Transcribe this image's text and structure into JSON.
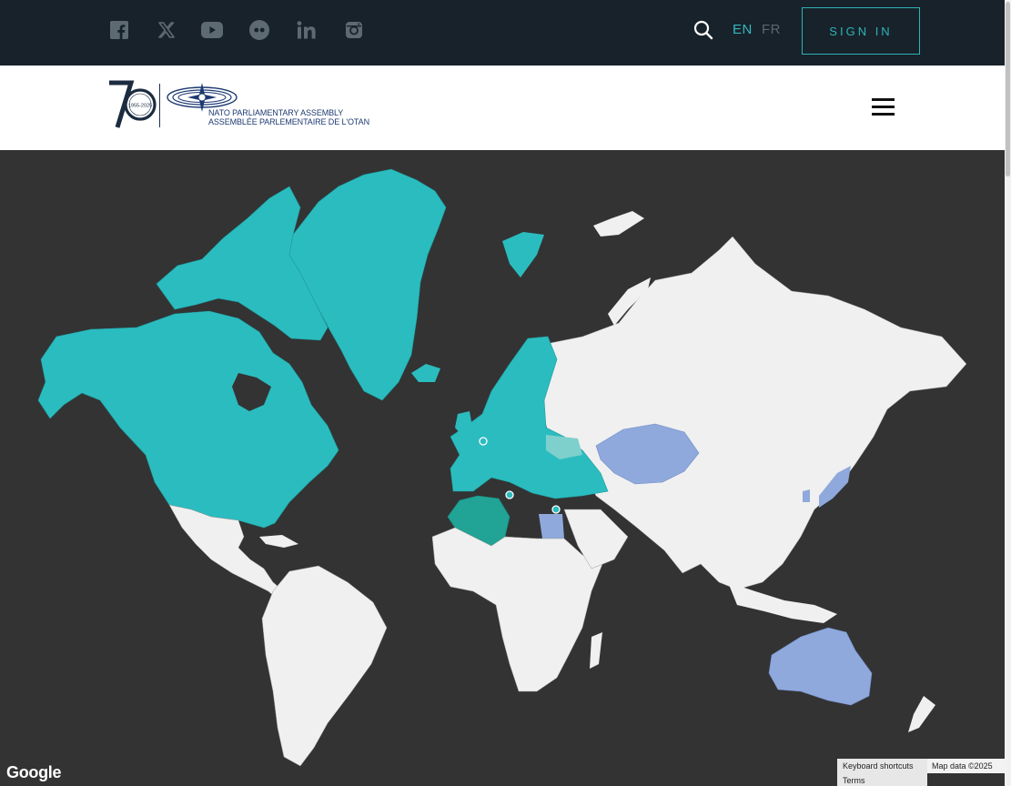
{
  "topbar": {
    "social": [
      {
        "name": "facebook-icon"
      },
      {
        "name": "x-icon"
      },
      {
        "name": "youtube-icon"
      },
      {
        "name": "flickr-icon"
      },
      {
        "name": "linkedin-icon"
      },
      {
        "name": "instagram-icon"
      }
    ],
    "lang_en": "EN",
    "lang_fr": "FR",
    "signin": "SIGN IN",
    "colors": {
      "bar": "#17222a",
      "accent": "#2fb3b8",
      "icon": "#5e6a72"
    }
  },
  "header": {
    "logo_years": "1955-2025",
    "logo_line1": "NATO PARLIAMENTARY ASSEMBLY",
    "logo_line2": "ASSEMBLÉE PARLEMENTAIRE DE L'OTAN"
  },
  "map": {
    "colors": {
      "ocean": "#333333",
      "land": "#f0f0f0",
      "member": "#2bbcbf",
      "associate": "#21a396",
      "partner": "#8fa9dc"
    },
    "google": "Google",
    "keyboard_shortcuts": "Keyboard shortcuts",
    "map_data": "Map data ©2025",
    "terms": "Terms"
  }
}
